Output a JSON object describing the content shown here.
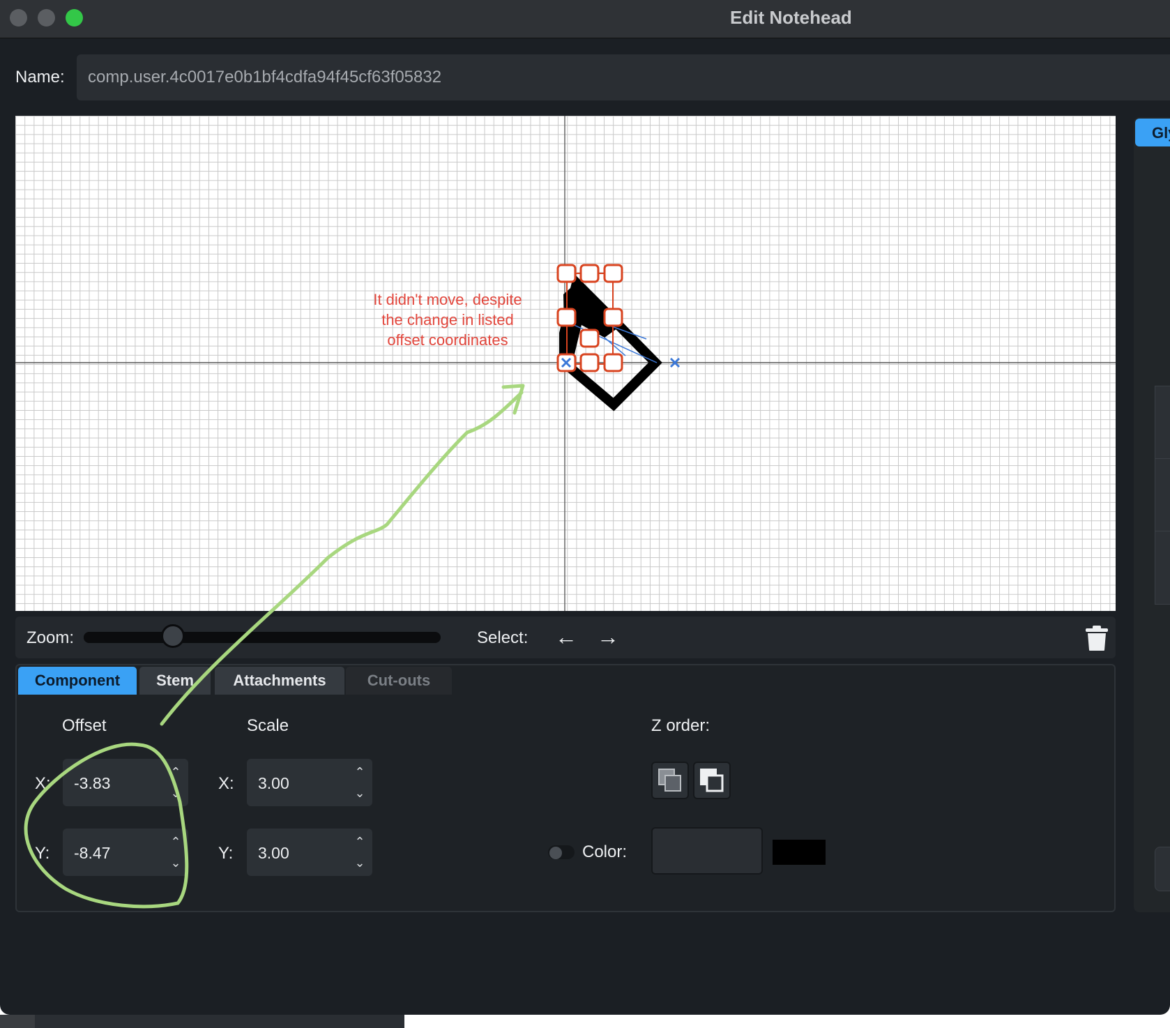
{
  "window": {
    "title": "Edit Notehead"
  },
  "name": {
    "label": "Name:",
    "value": "comp.user.4c0017e0b1bf4cdfa94f45cf63f05832"
  },
  "side_tab": {
    "label": "Gly"
  },
  "annotation": {
    "lines": [
      "It didn't move, despite",
      "the change in listed",
      "offset coordinates"
    ]
  },
  "toolbar": {
    "zoom_label": "Zoom:",
    "zoom_level": 0.25,
    "select_label": "Select:",
    "prev_icon": "arrow-left-icon",
    "next_icon": "arrow-right-icon",
    "delete_icon": "trash-icon"
  },
  "tabs": [
    {
      "label": "Component",
      "state": "active"
    },
    {
      "label": "Stem",
      "state": "normal"
    },
    {
      "label": "Attachments",
      "state": "normal"
    },
    {
      "label": "Cut-outs",
      "state": "disabled"
    }
  ],
  "component": {
    "offset": {
      "label": "Offset",
      "x_label": "X:",
      "x_value": "-3.83",
      "y_label": "Y:",
      "y_value": "-8.47"
    },
    "scale": {
      "label": "Scale",
      "x_label": "X:",
      "x_value": "3.00",
      "y_label": "Y:",
      "y_value": "3.00"
    },
    "z_order": {
      "label": "Z order:",
      "back_icon": "send-backward-icon",
      "front_icon": "bring-forward-icon"
    },
    "color": {
      "label": "Color:",
      "enabled": false,
      "value": "",
      "swatch": "#000000"
    }
  },
  "colors": {
    "accent": "#3aa1f5",
    "annotation_text": "#e2463c",
    "annotation_highlight": "#a8d77f",
    "selection_handle": "#d8431f",
    "attachment_marker": "#3b78d8"
  }
}
